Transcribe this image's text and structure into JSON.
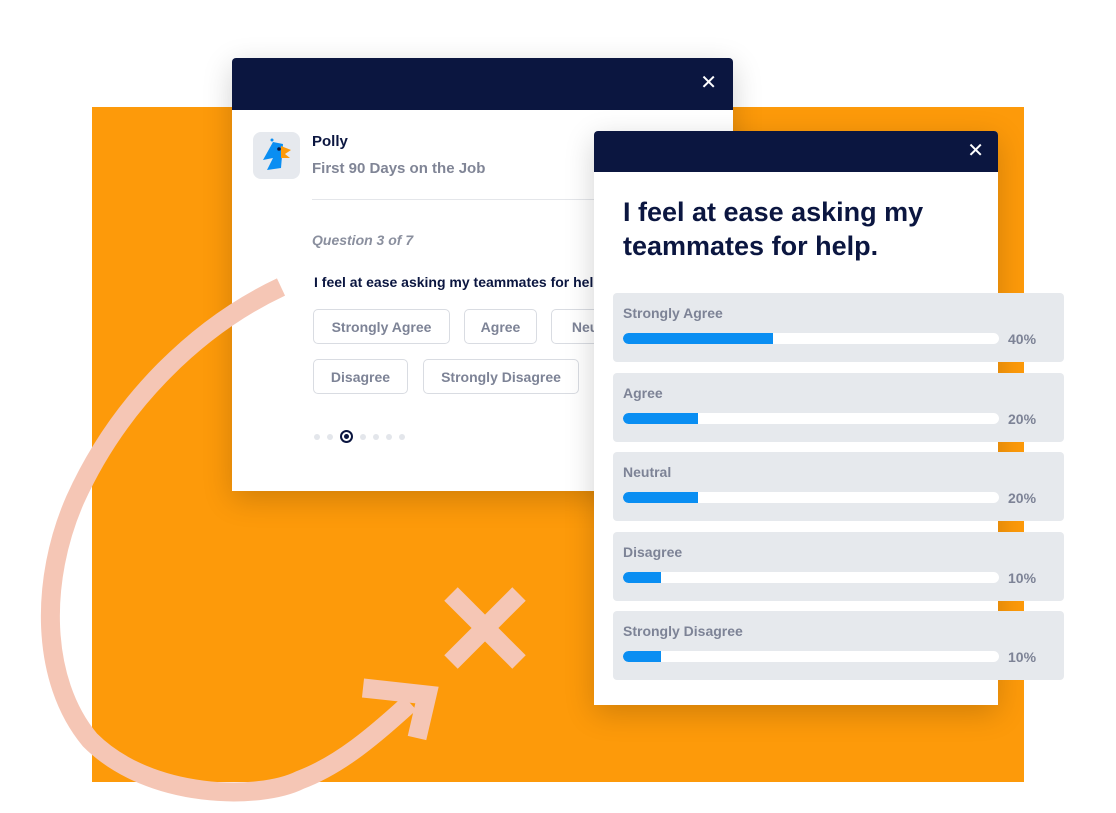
{
  "colors": {
    "accent": "#fd9a0a",
    "header": "#0b1640",
    "bar": "#0a8ef2",
    "decoration": "#f5c6b5"
  },
  "survey_card": {
    "close_icon": "close-icon",
    "app_name": "Polly",
    "survey_title": "First 90 Days on the Job",
    "question_count": "Question 3 of 7",
    "question": "I feel at ease asking my teammates for help.",
    "options": [
      "Strongly Agree",
      "Agree",
      "Neutral",
      "Disagree",
      "Strongly Disagree"
    ],
    "pager": {
      "total": 7,
      "current": 3
    }
  },
  "results_card": {
    "close_icon": "close-icon",
    "title": "I feel at ease asking my teammates for help.",
    "results": [
      {
        "label": "Strongly Agree",
        "percent": 40,
        "percent_label": "40%"
      },
      {
        "label": "Agree",
        "percent": 20,
        "percent_label": "20%"
      },
      {
        "label": "Neutral",
        "percent": 20,
        "percent_label": "20%"
      },
      {
        "label": "Disagree",
        "percent": 10,
        "percent_label": "10%"
      },
      {
        "label": "Strongly Disagree",
        "percent": 10,
        "percent_label": "10%"
      }
    ]
  }
}
